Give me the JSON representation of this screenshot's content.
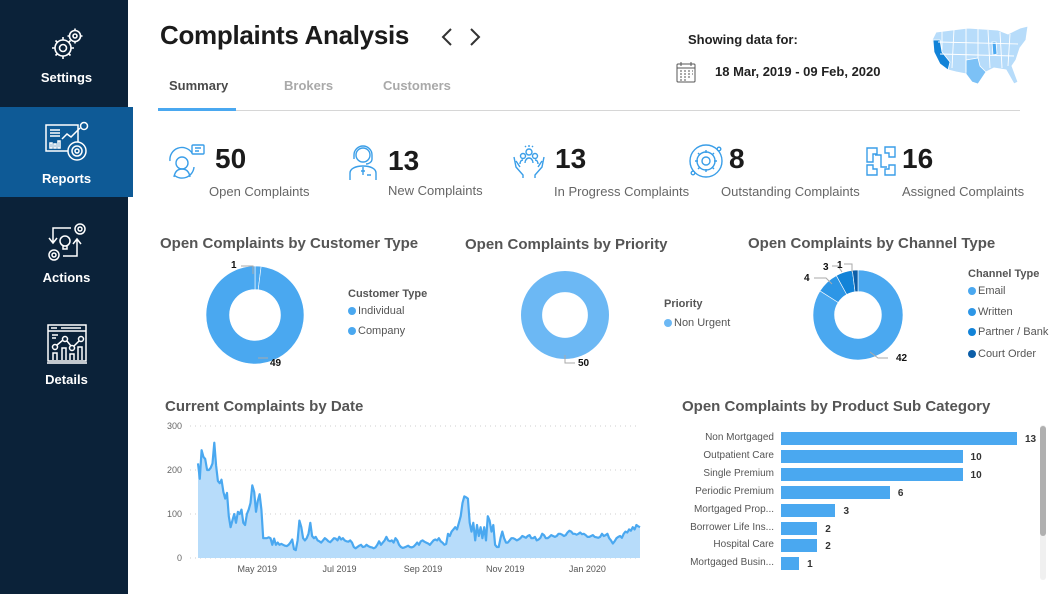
{
  "sidebar": {
    "items": [
      {
        "label": "Settings",
        "icon": "gears-icon",
        "active": false
      },
      {
        "label": "Reports",
        "icon": "report-dashboard-icon",
        "active": true
      },
      {
        "label": "Actions",
        "icon": "idea-process-icon",
        "active": false
      },
      {
        "label": "Details",
        "icon": "analytics-browser-icon",
        "active": false
      }
    ]
  },
  "header": {
    "title": "Complaints Analysis",
    "prev_label": "‹",
    "next_label": "›",
    "tabs": [
      {
        "label": "Summary",
        "active": true
      },
      {
        "label": "Brokers",
        "active": false
      },
      {
        "label": "Customers",
        "active": false
      }
    ],
    "showing_label": "Showing data for:",
    "date_range": "18 Mar, 2019 - 09 Feb, 2020"
  },
  "kpis": [
    {
      "value": "50",
      "label": "Open Complaints",
      "icon": "support-agent-icon"
    },
    {
      "value": "13",
      "label": "New Complaints",
      "icon": "headset-person-icon"
    },
    {
      "value": "13",
      "label": "In Progress Complaints",
      "icon": "team-hands-icon"
    },
    {
      "value": "8",
      "label": "Outstanding Complaints",
      "icon": "gear-cycle-icon"
    },
    {
      "value": "16",
      "label": "Assigned Complaints",
      "icon": "hands-collaboration-icon"
    }
  ],
  "colors": {
    "accent": "#4aa8f0",
    "light": "#6cb8f4",
    "written": "#2d96e6",
    "partner": "#1283d8",
    "court": "#0c5ea8",
    "area_fill": "#b7dcfa",
    "sidebar_bg": "#0b2239",
    "sidebar_active": "#0e5a96"
  },
  "chart_data": [
    {
      "type": "pie",
      "title": "Open Complaints by Customer Type",
      "legend_title": "Customer Type",
      "categories": [
        "Individual",
        "Company"
      ],
      "values": [
        49,
        1
      ],
      "labels": [
        "49",
        "1"
      ],
      "legend_position": "right"
    },
    {
      "type": "pie",
      "title": "Open Complaints by Priority",
      "legend_title": "Priority",
      "categories": [
        "Non Urgent"
      ],
      "values": [
        50
      ],
      "labels": [
        "50"
      ],
      "legend_position": "right"
    },
    {
      "type": "pie",
      "title": "Open Complaints by Channel Type",
      "legend_title": "Channel Type",
      "categories": [
        "Email",
        "Written",
        "Partner / Bank",
        "Court Order"
      ],
      "values": [
        42,
        4,
        3,
        1
      ],
      "labels": [
        "42",
        "4",
        "3",
        "1"
      ],
      "legend_position": "right"
    },
    {
      "type": "area",
      "title": "Current Complaints by Date",
      "xlabel": "",
      "ylabel": "",
      "ylim": [
        0,
        300
      ],
      "yticks": [
        "0",
        "100",
        "200",
        "300"
      ],
      "xticks": [
        "May 2019",
        "Jul 2019",
        "Sep 2019",
        "Nov 2019",
        "Jan 2020"
      ],
      "x_range": [
        "2019-03-18",
        "2020-02-09"
      ],
      "grid": true,
      "values": [
        215,
        180,
        245,
        230,
        225,
        200,
        200,
        205,
        215,
        262,
        210,
        175,
        170,
        178,
        150,
        135,
        148,
        95,
        70,
        85,
        100,
        80,
        105,
        100,
        110,
        80,
        75,
        100,
        110,
        125,
        165,
        150,
        105,
        130,
        145,
        110,
        45,
        45,
        45,
        47,
        45,
        30,
        44,
        30,
        35,
        30,
        32,
        30,
        28,
        27,
        30,
        35,
        42,
        20,
        18,
        40,
        85,
        70,
        45,
        40,
        45,
        55,
        80,
        50,
        45,
        48,
        40,
        38,
        35,
        40,
        45,
        42,
        38,
        36,
        40,
        45,
        44,
        40,
        48,
        42,
        45,
        40,
        38,
        37,
        40,
        35,
        25,
        22,
        25,
        28,
        30,
        25,
        26,
        30,
        27,
        25,
        24,
        22,
        24,
        30,
        38,
        30,
        35,
        40,
        48,
        40,
        38,
        40,
        35,
        45,
        40,
        30,
        25,
        23,
        24,
        26,
        28,
        25,
        24,
        26,
        30,
        35,
        30,
        38,
        40,
        37,
        35,
        33,
        30,
        35,
        40,
        42,
        40,
        45,
        38,
        35,
        30,
        32,
        55,
        50,
        60,
        65,
        70,
        65,
        80,
        95,
        125,
        140,
        138,
        135,
        80,
        60,
        80,
        40,
        75,
        50,
        70,
        45,
        70,
        40,
        95,
        85,
        60,
        75,
        30,
        25,
        25,
        45,
        60,
        45,
        35,
        35,
        40,
        45,
        45,
        43,
        40,
        42,
        45,
        50,
        48,
        46,
        50,
        52,
        45,
        45,
        48,
        40,
        42,
        46,
        55,
        52,
        45,
        45,
        48,
        52,
        50,
        48,
        50,
        55,
        55,
        53,
        50,
        52,
        58,
        62,
        60,
        55,
        55,
        53,
        55,
        58,
        54,
        55,
        52,
        48,
        48,
        50,
        52,
        48,
        47,
        46,
        48,
        55,
        50,
        52,
        55,
        45,
        40,
        33,
        38,
        45,
        48,
        50,
        46,
        55,
        60,
        58,
        65,
        62,
        70,
        65,
        75,
        72,
        70
      ]
    },
    {
      "type": "bar",
      "orientation": "horizontal",
      "title": "Open Complaints by Product Sub Category",
      "categories": [
        "Non Mortgaged",
        "Outpatient Care",
        "Single Premium",
        "Periodic Premium",
        "Mortgaged Prop...",
        "Borrower Life Ins...",
        "Hospital Care",
        "Mortgaged Busin..."
      ],
      "values": [
        13,
        10,
        10,
        6,
        3,
        2,
        2,
        1
      ],
      "xlim": [
        0,
        13
      ]
    }
  ]
}
